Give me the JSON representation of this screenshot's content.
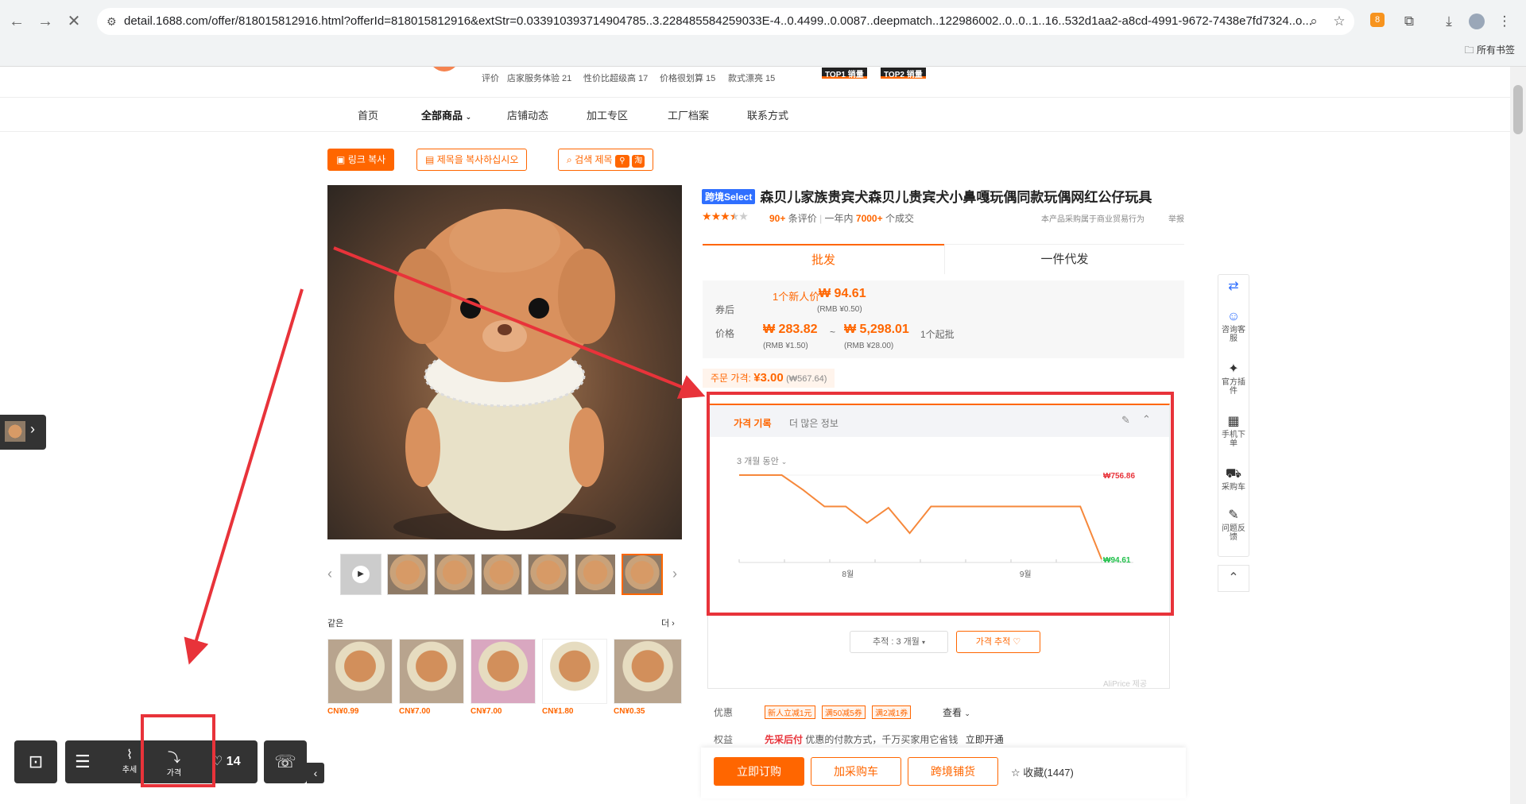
{
  "browser": {
    "url": "detail.1688.com/offer/818015812916.html?offerId=818015812916&extStr=0.033910393714904785..3.228485584259033E-4..0.4499..0.0087..deepmatch..122986002..0..0..1..16..532d1aa2-a8cd-4991-9672-7438e7fd7324..o...",
    "bookmarks_label": "所有书签",
    "extension_badge": "8"
  },
  "shop": {
    "rating_label": "评价",
    "badges": [
      "店家服务体验 21",
      "性价比超级高 17",
      "价格很划算 15",
      "款式漂亮 15"
    ],
    "top_badges": [
      "TOP1 销量",
      "TOP2 销量"
    ]
  },
  "nav": {
    "items": [
      "首页",
      "全部商品",
      "店铺动态",
      "加工专区",
      "工厂档案",
      "联系方式"
    ]
  },
  "toolbar": {
    "copy_link": "링크 복사",
    "copy_title": "제목을 복사하십시오",
    "search_title": "검색 제목"
  },
  "product": {
    "select_badge": "跨境Select",
    "title": "森贝儿家族贵宾犬森贝儿贵宾犬小鼻嘎玩偶同款玩偶网红公仔玩具",
    "reviews_count": "90+",
    "reviews_label": "条评价",
    "sales_prefix": "一年内",
    "sales_count": "7000+",
    "sales_suffix": "个成交",
    "notice": "本产品采购属于商业贸易行为",
    "report": "举报",
    "rating": 3.5
  },
  "tabs": [
    "批发",
    "一件代发"
  ],
  "pricing": {
    "coupon_label": "券后",
    "newbie_label": "1个新人价",
    "newbie_price": "₩ 94.61",
    "newbie_rmb": "(RMB ¥0.50)",
    "price_label": "价格",
    "price_low": "₩ 283.82",
    "price_tilde": "~",
    "price_high": "₩ 5,298.01",
    "min_order": "1个起批",
    "price_low_rmb": "(RMB ¥1.50)",
    "price_high_rmb": "(RMB ¥28.00)",
    "order_price_label": "주문 가격:",
    "order_price": "¥3.00",
    "order_price_krw": "(₩567.64)"
  },
  "price_panel": {
    "tab_active": "가격 기록",
    "tab_more": "더 많은 정보",
    "range_label": "3 개월 동안",
    "track_select": "추적 : 3 개월",
    "track_button": "가격 추적",
    "provider": "AliPrice 제공"
  },
  "chart_data": {
    "type": "line",
    "title": "",
    "xlabel": "",
    "ylabel": "",
    "x_ticks": [
      "8월",
      "9월"
    ],
    "max_label": "₩756.86",
    "min_label": "₩94.61",
    "ylim": [
      94.61,
      756.86
    ],
    "series": [
      {
        "values": [
          756.86,
          756.86,
          756.86,
          640,
          510,
          510,
          380,
          500,
          300,
          510,
          510,
          510,
          510,
          510,
          510,
          510,
          510,
          94.61
        ]
      }
    ]
  },
  "promotions": {
    "label": "优惠",
    "coupons": [
      "新人立减1元",
      "满50减5券",
      "满2减1券"
    ],
    "view": "查看"
  },
  "benefits": {
    "label": "权益",
    "highlight": "先采后付",
    "text": "优惠的付款方式，千万买家用它省钱",
    "action": "立即开通"
  },
  "actions": {
    "buy_now": "立即订购",
    "add_cart": "加采购车",
    "cross_border": "跨境铺货",
    "favorite": "收藏(1447)"
  },
  "sidebar": {
    "items": [
      "咨询客服",
      "官方插件",
      "手机下单",
      "采购车",
      "问题反馈"
    ]
  },
  "similar": {
    "title": "같은",
    "more": "더",
    "prices": [
      "CN¥0.99",
      "CN¥7.00",
      "CN¥7.00",
      "CN¥1.80",
      "CN¥0.35"
    ]
  },
  "floating": {
    "trend_label": "추세",
    "price_label": "가격",
    "fav_count": "14"
  },
  "colors": {
    "accent": "#ff6a00",
    "annotation": "#e8333a",
    "chart_line": "#f6883b",
    "chart_min": "#21c04b"
  }
}
